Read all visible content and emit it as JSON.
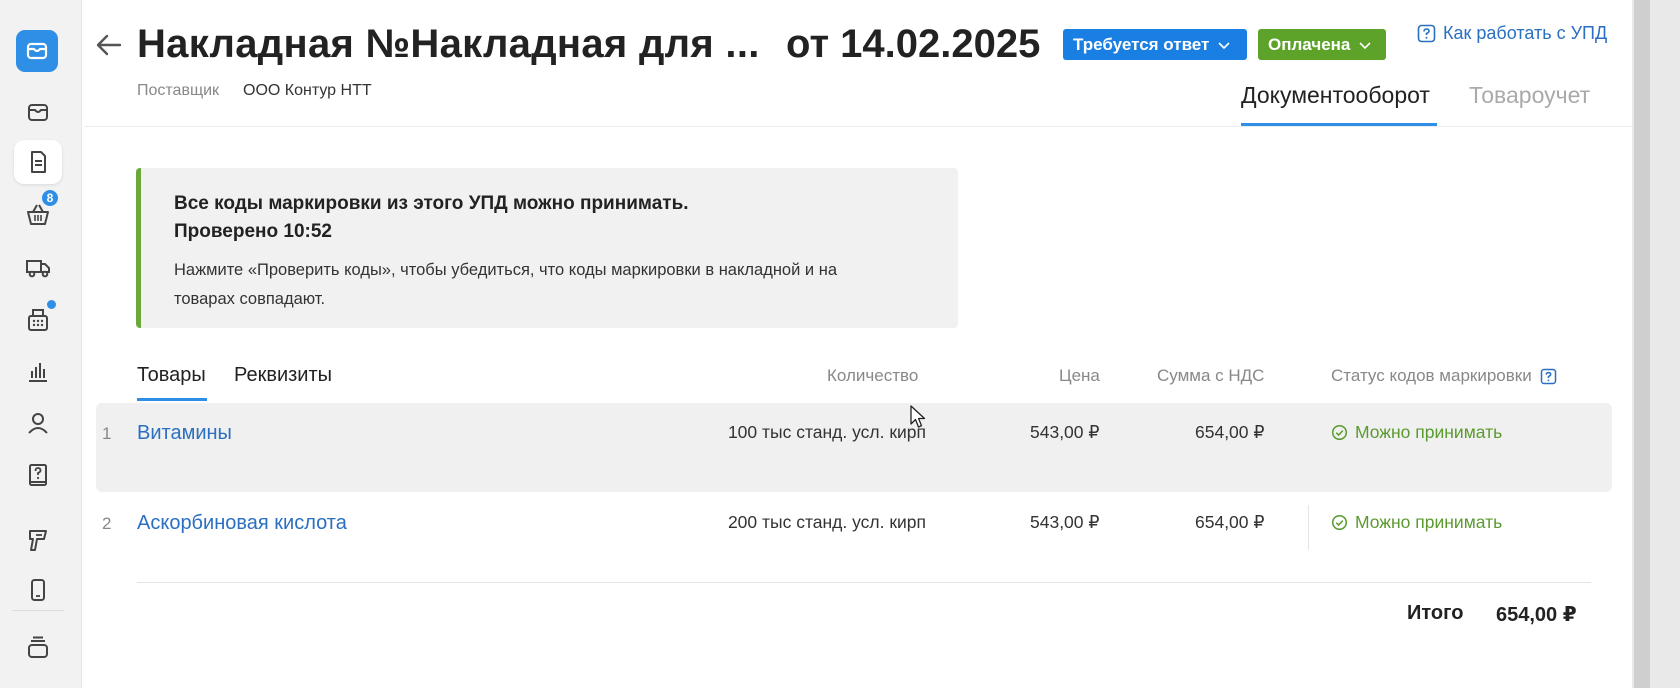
{
  "header": {
    "title": "Накладная №Накладная для ...",
    "date": "от 14.02.2025",
    "status_reply": "Требуется ответ",
    "status_paid": "Оплачена",
    "help_link": "Как работать с УПД",
    "supplier_label": "Поставщик",
    "supplier_value": "ООО Контур НТТ",
    "tabs": [
      "Документооборот",
      "Товароучет"
    ],
    "active_tab": "Документооборот"
  },
  "sidebar": {
    "items": [
      {
        "icon": "mail-icon"
      },
      {
        "icon": "inbox-icon"
      },
      {
        "icon": "document-icon",
        "active": true
      },
      {
        "icon": "basket-icon",
        "badge": "8"
      },
      {
        "icon": "truck-icon"
      },
      {
        "icon": "cash-register-icon",
        "dot": true
      },
      {
        "icon": "bar-chart-icon"
      },
      {
        "icon": "user-icon"
      },
      {
        "icon": "help-book-icon"
      },
      {
        "icon": "scanner-icon"
      },
      {
        "icon": "phone-icon"
      },
      {
        "icon": "layers-icon"
      }
    ]
  },
  "notice": {
    "title": "Все коды маркировки из этого УПД можно принимать.",
    "checked": "Проверено 10:52",
    "text": "Нажмите «Проверить коды», чтобы убедиться, что коды маркировки в накладной и на товарах совпадают.",
    "accent_color": "#6aa83a"
  },
  "content_tabs": [
    "Товары",
    "Реквизиты"
  ],
  "table": {
    "columns": {
      "quantity": "Количество",
      "price": "Цена",
      "sum_vat": "Сумма с НДС",
      "marking_status": "Статус кодов маркировки"
    },
    "rows": [
      {
        "num": "1",
        "name": "Витамины",
        "quantity": "100 тыс станд. усл. кирп",
        "price": "543,00 ₽",
        "sum": "654,00 ₽",
        "status": "Можно принимать"
      },
      {
        "num": "2",
        "name": "Аскорбиновая кислота",
        "quantity": "200 тыс станд. усл. кирп",
        "price": "543,00 ₽",
        "sum": "654,00 ₽",
        "status": "Можно принимать"
      }
    ],
    "total_label": "Итого",
    "total_value": "654,00 ₽"
  },
  "colors": {
    "accent": "#2f8fe6",
    "status_reply": "#1a7fe2",
    "status_paid": "#5da32a",
    "status_ok": "#5b9a2f",
    "link": "#2a6fc1"
  }
}
